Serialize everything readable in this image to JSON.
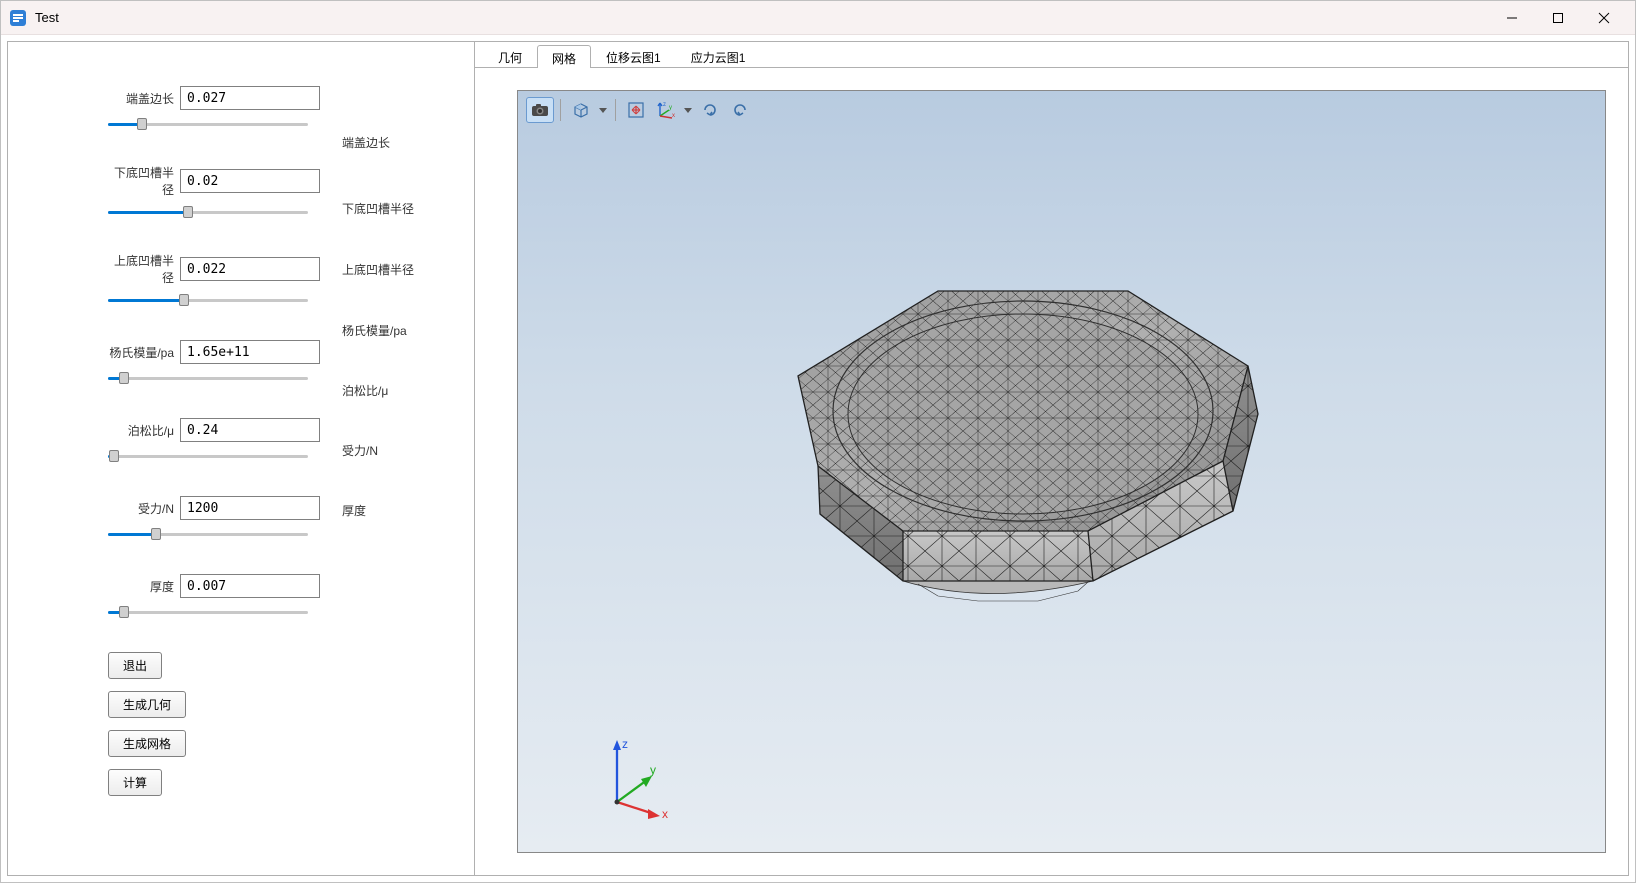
{
  "window": {
    "title": "Test"
  },
  "tabs": {
    "geometry": "几何",
    "mesh": "网格",
    "disp": "位移云图1",
    "stress": "应力云图1"
  },
  "params": [
    {
      "label": "端盖边长",
      "value": "0.027",
      "sliderPct": 17,
      "right": "端盖边长",
      "rightTop": 92
    },
    {
      "label": "下底凹槽半径",
      "value": "0.02",
      "sliderPct": 40,
      "right": "下底凹槽半径",
      "rightTop": 158
    },
    {
      "label": "上底凹槽半径",
      "value": "0.022",
      "sliderPct": 38,
      "right": "上底凹槽半径",
      "rightTop": 219
    },
    {
      "label": "杨氏模量/pa",
      "value": "1.65e+11",
      "sliderPct": 8,
      "right": "杨氏模量/pa",
      "rightTop": 280
    },
    {
      "label": "泊松比/μ",
      "value": "0.24",
      "sliderPct": 3,
      "right": "泊松比/μ",
      "rightTop": 340
    },
    {
      "label": "受力/N",
      "value": "1200",
      "sliderPct": 24,
      "right": "受力/N",
      "rightTop": 400
    },
    {
      "label": "厚度",
      "value": "0.007",
      "sliderPct": 8,
      "right": "厚度",
      "rightTop": 460
    }
  ],
  "buttons": {
    "exit": "退出",
    "genGeometry": "生成几何",
    "genMesh": "生成网格",
    "compute": "计算"
  },
  "axes": {
    "x": "x",
    "y": "y",
    "z": "z"
  }
}
